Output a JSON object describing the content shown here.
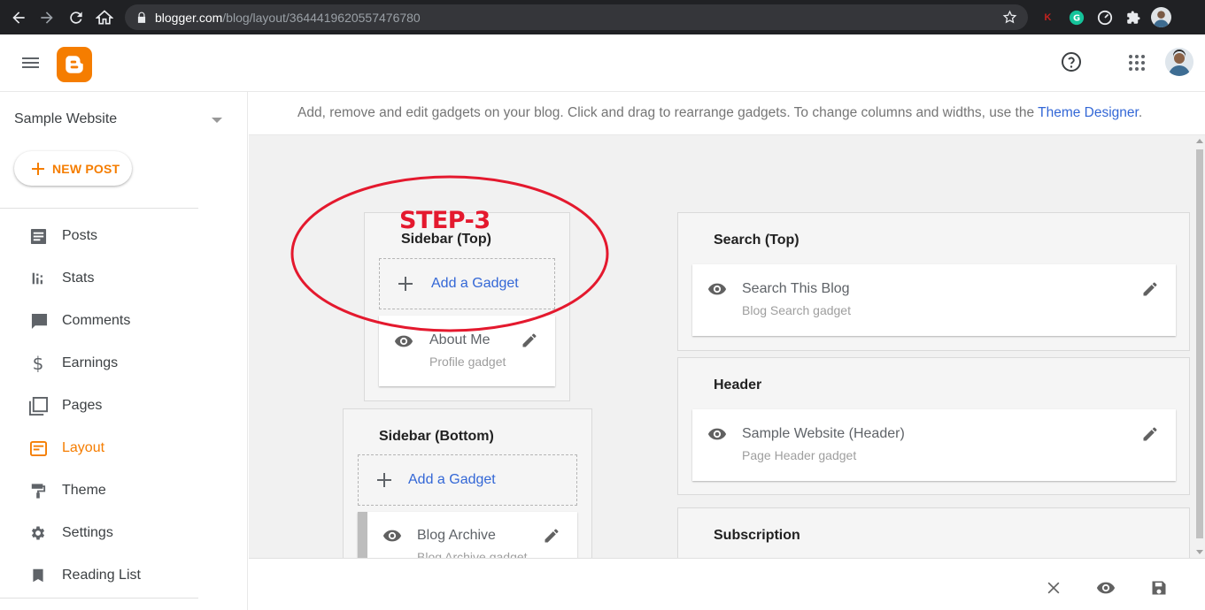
{
  "browser": {
    "url_host": "blogger.com",
    "url_path": "/blog/layout/3644419620557476780"
  },
  "app": {
    "logo_letter": "B",
    "brand_color": "#f57d00"
  },
  "sidebar": {
    "blog_name": "Sample Website",
    "new_post_label": "NEW POST",
    "items": [
      {
        "label": "Posts",
        "icon": "posts-icon",
        "active": false
      },
      {
        "label": "Stats",
        "icon": "stats-icon",
        "active": false
      },
      {
        "label": "Comments",
        "icon": "comments-icon",
        "active": false
      },
      {
        "label": "Earnings",
        "icon": "earnings-icon",
        "active": false
      },
      {
        "label": "Pages",
        "icon": "pages-icon",
        "active": false
      },
      {
        "label": "Layout",
        "icon": "layout-icon",
        "active": true
      },
      {
        "label": "Theme",
        "icon": "theme-icon",
        "active": false
      },
      {
        "label": "Settings",
        "icon": "settings-icon",
        "active": false
      },
      {
        "label": "Reading List",
        "icon": "reading-list-icon",
        "active": false
      }
    ]
  },
  "info_bar": {
    "message": "Add, remove and edit gadgets on your blog. Click and drag to rearrange gadgets. To change columns and widths, use the ",
    "link": "Theme Designer",
    "period": "."
  },
  "annotation": {
    "step_label": "STEP-3",
    "color": "#e4192e"
  },
  "sections": {
    "sidebar_top": {
      "title": "Sidebar (Top)",
      "add_label": "Add a Gadget",
      "gadgets": [
        {
          "name": "About Me",
          "type": "Profile gadget"
        }
      ]
    },
    "sidebar_bottom": {
      "title": "Sidebar (Bottom)",
      "add_label": "Add a Gadget",
      "gadgets": [
        {
          "name": "Blog Archive",
          "type": "Blog Archive gadget"
        }
      ]
    },
    "search_top": {
      "title": "Search (Top)",
      "gadgets": [
        {
          "name": "Search This Blog",
          "type": "Blog Search gadget"
        }
      ]
    },
    "header": {
      "title": "Header",
      "gadgets": [
        {
          "name": "Sample Website (Header)",
          "type": "Page Header gadget"
        }
      ]
    },
    "subscription": {
      "title": "Subscription"
    }
  },
  "colors": {
    "link": "#3367d6",
    "canvas": "#f1f1f1",
    "chrome": "#202124"
  }
}
